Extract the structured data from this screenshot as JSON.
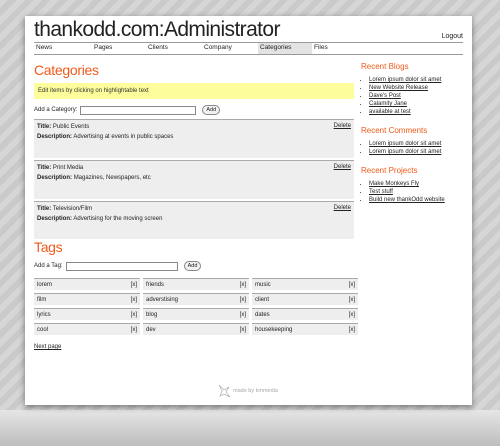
{
  "site": {
    "title": "thankodd.com:Administrator",
    "logout": "Logout"
  },
  "nav": [
    {
      "label": "News"
    },
    {
      "label": "Pages"
    },
    {
      "label": "Clients"
    },
    {
      "label": "Company"
    },
    {
      "label": "Categories"
    },
    {
      "label": "Files"
    }
  ],
  "categories": {
    "title": "Categories",
    "notice": "Edit items by clicking on highlightable text",
    "add_label": "Add a Category:",
    "add_value": "",
    "add_button": "Add",
    "title_label": "Title:",
    "description_label": "Description:",
    "delete_label": "Delete",
    "items": [
      {
        "title": "Public Events",
        "description": "Advertising at events in public spaces"
      },
      {
        "title": "Print Media",
        "description": "Magazines, Newspapers, etc"
      },
      {
        "title": "Television/Film",
        "description": "Advertising for the moving screen"
      }
    ]
  },
  "tags": {
    "title": "Tags",
    "add_label": "Add a Tag:",
    "add_value": "",
    "add_button": "Add",
    "remove_label": "[x]",
    "items": [
      {
        "label": "lorem"
      },
      {
        "label": "friends"
      },
      {
        "label": "music"
      },
      {
        "label": "film"
      },
      {
        "label": "adverstising"
      },
      {
        "label": "client"
      },
      {
        "label": "lyrics"
      },
      {
        "label": "blog"
      },
      {
        "label": "dates"
      },
      {
        "label": "cool"
      },
      {
        "label": "dev"
      },
      {
        "label": "housekeeping"
      }
    ],
    "next_page": "Next page"
  },
  "sidebar": {
    "recent_blogs": {
      "title": "Recent Blogs",
      "items": [
        "Lorem ipsum dolor sit amet",
        "New Website Release",
        "Dave's Post",
        "Calamity Jane",
        "available at test"
      ]
    },
    "recent_comments": {
      "title": "Recent Comments",
      "items": [
        "Lorem ipsum dolor sit amet",
        "Lorem ipsum dolor sit amet"
      ]
    },
    "recent_projects": {
      "title": "Recent Projects",
      "items": [
        "Make Monkeys Fly",
        "Test stuff",
        "Build new thankOdd website"
      ]
    }
  },
  "footer": {
    "text": "made by kmmedia"
  },
  "colors": {
    "accent": "#f05a1a",
    "notice_bg": "#fdfd9b",
    "card_bg": "#eeeeee"
  }
}
